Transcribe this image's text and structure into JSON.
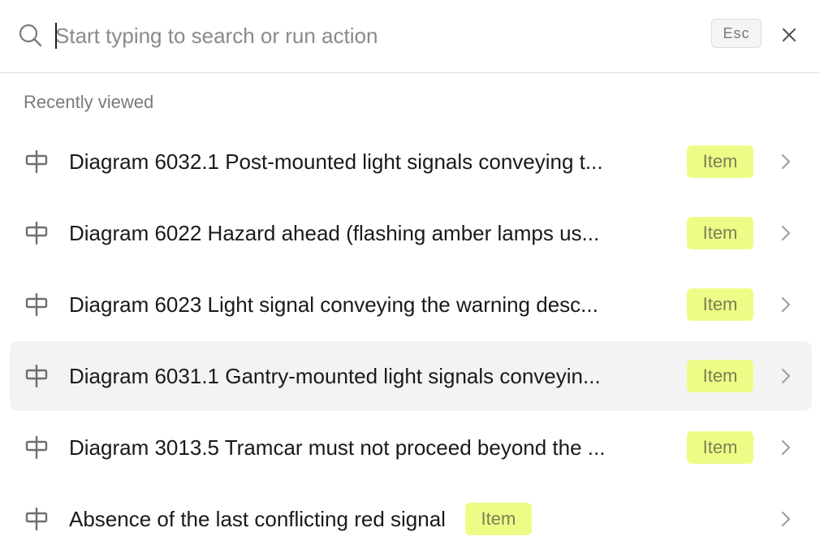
{
  "search": {
    "placeholder": "Start typing to search or run action",
    "value": "",
    "esc_label": "Esc"
  },
  "section": {
    "label": "Recently viewed"
  },
  "items": [
    {
      "title": "Diagram 6032.1 Post-mounted light signals conveying t...",
      "badge": "Item",
      "icon": "signpost-icon",
      "active": false
    },
    {
      "title": "Diagram 6022 Hazard ahead (flashing amber lamps us...",
      "badge": "Item",
      "icon": "signpost-icon",
      "active": false
    },
    {
      "title": "Diagram 6023 Light signal conveying the warning desc...",
      "badge": "Item",
      "icon": "signpost-icon",
      "active": false
    },
    {
      "title": "Diagram 6031.1 Gantry-mounted light signals conveyin...",
      "badge": "Item",
      "icon": "signpost-icon",
      "active": true
    },
    {
      "title": "Diagram 3013.5 Tramcar must not proceed beyond the ...",
      "badge": "Item",
      "icon": "signpost-icon",
      "active": false
    },
    {
      "title": "Absence of the last conflicting red signal",
      "badge": "Item",
      "icon": "signpost-icon",
      "active": false
    }
  ],
  "colors": {
    "badge_bg": "#edfc86",
    "badge_text": "#7a7f55",
    "active_row_bg": "#f3f3f3"
  }
}
